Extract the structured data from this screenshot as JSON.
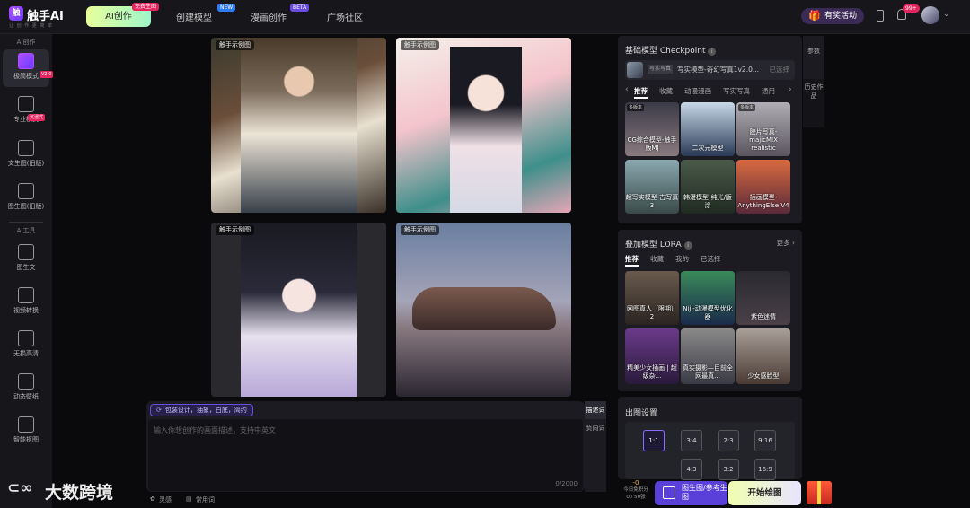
{
  "brand": {
    "name": "触手AI",
    "sub": "让 创 作 更 简 单"
  },
  "nav": [
    {
      "label": "AI创作",
      "badge": "免费生图"
    },
    {
      "label": "创建模型",
      "badge": "NEW"
    },
    {
      "label": "漫画创作",
      "badge": "BETA"
    },
    {
      "label": "广场社区"
    }
  ],
  "topright": {
    "event": "有奖活动",
    "notif_count": "99+"
  },
  "sidebar": {
    "head_create": "AI创作",
    "items": [
      {
        "label": "极简模式",
        "badge": "V2.0"
      },
      {
        "label": "专业模式",
        "badge": "沉浸式"
      },
      {
        "label": "文生图(旧版)"
      },
      {
        "label": "图生图(旧版)"
      }
    ],
    "head_tools": "AI工具",
    "tools": [
      {
        "label": "图生文"
      },
      {
        "label": "视频转换"
      },
      {
        "label": "无损高清"
      },
      {
        "label": "动态壁纸"
      },
      {
        "label": "智能抠图"
      }
    ]
  },
  "gallery": {
    "tag": "触手示例图"
  },
  "prompt": {
    "chip": "包装设计，抽象，白底，简约",
    "placeholder": "输入你想创作的画面描述，支持中英文",
    "counter": "0/2000",
    "tab_describe": "描述词",
    "tab_negative": "负向词",
    "bottom_inspire": "灵感",
    "bottom_common": "常用词"
  },
  "checkpoint": {
    "title": "基础模型 Checkpoint",
    "selected_tag": "写实写真",
    "selected_name": "写实模型-奇幻写真1v2.0...",
    "selected_status": "已选择",
    "tabs": [
      "推荐",
      "收藏",
      "动漫漫画",
      "写实写真",
      "通用"
    ],
    "cards": [
      {
        "label": "CG综合模型-触手版MJ",
        "tag": "多版本"
      },
      {
        "label": "二次元模型",
        "tag": ""
      },
      {
        "label": "胶片写真-majicMIX realistic",
        "tag": "多版本"
      },
      {
        "label": "超写实模型-古写真3",
        "tag": ""
      },
      {
        "label": "韩漫模型-纯光/版涂",
        "tag": ""
      },
      {
        "label": "插画模型-AnythingElse V4",
        "tag": ""
      }
    ]
  },
  "lora": {
    "title": "叠加模型 LORA",
    "more": "更多",
    "tabs": [
      "推荐",
      "收藏",
      "我的",
      "已选择"
    ],
    "cards": [
      {
        "label": "网图真人（限期）2"
      },
      {
        "label": "Niji-动漫模型优化器"
      },
      {
        "label": "紫色迷情"
      },
      {
        "label": "精美少女插画 | 超级杂..."
      },
      {
        "label": "真实摄影—目前全网最真..."
      },
      {
        "label": "少女感脸型"
      }
    ]
  },
  "output": {
    "title": "出图设置",
    "ratios": [
      "1:1",
      "3:4",
      "2:3",
      "9:16",
      "4:3",
      "3:2",
      "16:9"
    ],
    "selected": "1:1"
  },
  "side_tabs": {
    "params": "参数",
    "history": "历史作品"
  },
  "actions": {
    "credits_value": "-0",
    "credits_label": "今日免积分",
    "credits_count": "0 / 50张",
    "ref_button": "图生图/参考生图",
    "generate_button": "开始绘图"
  },
  "watermark": "大数跨境"
}
